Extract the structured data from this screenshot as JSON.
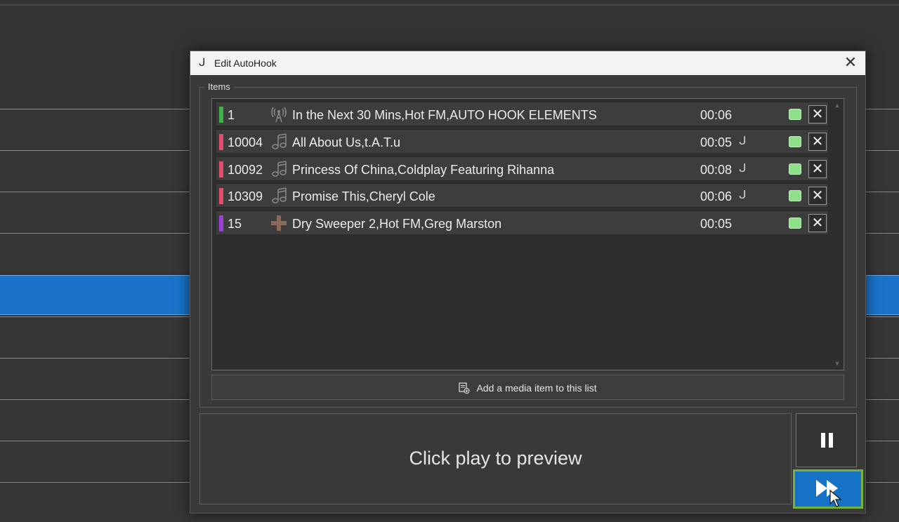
{
  "dialog": {
    "title": "Edit AutoHook",
    "title_icon": "hook-icon",
    "close_glyph": "✕"
  },
  "items_group": {
    "label": "Items"
  },
  "items": [
    {
      "number": "1",
      "type_icon": "broadcast-tower-icon",
      "title": "In the Next 30 Mins,Hot FM,AUTO HOOK ELEMENTS",
      "duration": "00:06",
      "hook": "",
      "color": "#3fb44a",
      "enabled": true
    },
    {
      "number": "10004",
      "type_icon": "music-note-icon",
      "title": "All About Us,t.A.T.u",
      "duration": "00:05",
      "hook": "ᒍ",
      "color": "#e0506a",
      "enabled": true
    },
    {
      "number": "10092",
      "type_icon": "music-note-icon",
      "title": "Princess Of China,Coldplay Featuring Rihanna",
      "duration": "00:08",
      "hook": "ᒍ",
      "color": "#e0506a",
      "enabled": true
    },
    {
      "number": "10309",
      "type_icon": "music-note-icon",
      "title": "Promise This,Cheryl Cole",
      "duration": "00:06",
      "hook": "ᒍ",
      "color": "#e0506a",
      "enabled": true
    },
    {
      "number": "15",
      "type_icon": "sweeper-cross-icon",
      "title": "Dry Sweeper 2,Hot FM,Greg Marston",
      "duration": "00:05",
      "hook": "",
      "color": "#9b3fd6",
      "enabled": true
    }
  ],
  "add_button": {
    "label": "Add a media item to this list"
  },
  "preview": {
    "text": "Click play to preview"
  },
  "colors": {
    "accent_blue": "#1672c4",
    "focus_green": "#77b13a",
    "toggle_green": "#8ee08a"
  }
}
